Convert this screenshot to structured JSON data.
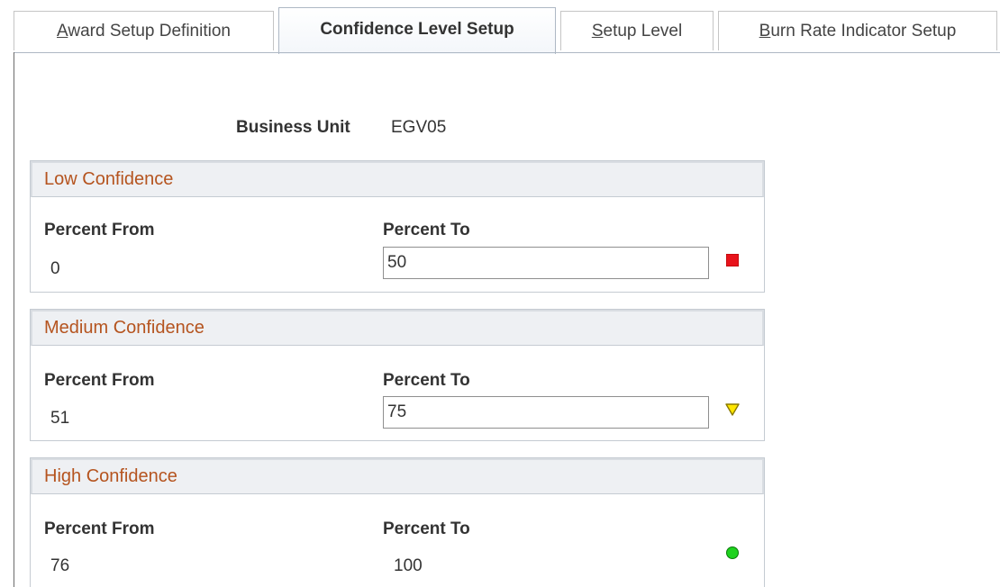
{
  "tabs": [
    {
      "label_first": "A",
      "label_rest": "ward Setup Definition",
      "active": false
    },
    {
      "label_first": "",
      "label_rest": "Confidence Level Setup",
      "active": true
    },
    {
      "label_first": "S",
      "label_rest": "etup Level",
      "active": false
    },
    {
      "label_first": "B",
      "label_rest": "urn Rate Indicator Setup",
      "active": false
    }
  ],
  "business_unit": {
    "label": "Business Unit",
    "value": "EGV05"
  },
  "groups": [
    {
      "title": "Low Confidence",
      "percent_from_label": "Percent From",
      "percent_from_value": "0",
      "percent_to_label": "Percent To",
      "percent_to_value": "50",
      "indicator": {
        "icon": "red-square-icon",
        "color": "#e8131b"
      }
    },
    {
      "title": "Medium Confidence",
      "percent_from_label": "Percent From",
      "percent_from_value": "51",
      "percent_to_label": "Percent To",
      "percent_to_value": "75",
      "indicator": {
        "icon": "yellow-triangle-icon",
        "color": "#ffe600"
      }
    },
    {
      "title": "High Confidence",
      "percent_from_label": "Percent From",
      "percent_from_value": "76",
      "percent_to_label": "Percent To",
      "percent_to_value": "100",
      "indicator": {
        "icon": "green-circle-icon",
        "color": "#1ed21e"
      }
    }
  ]
}
